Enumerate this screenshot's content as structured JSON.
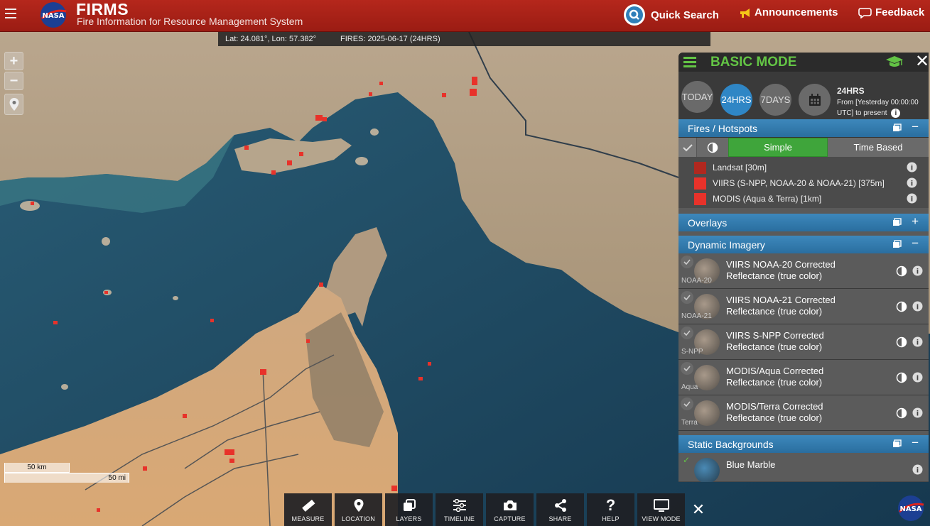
{
  "header": {
    "title": "FIRMS",
    "subtitle": "Fire Information for Resource Management System",
    "logo_text": "NASA",
    "quick_search": "Quick Search",
    "announcements": "Announcements",
    "feedback": "Feedback",
    "accent": "#b5271c"
  },
  "infobar": {
    "coords": "Lat: 24.081°, Lon: 57.382°",
    "fires": "FIRES: 2025-06-17 (24HRS)"
  },
  "zoom": {
    "in": "+",
    "out": "−"
  },
  "scale": {
    "km": "50 km",
    "mi": "50 mi"
  },
  "toolbar": {
    "items": [
      {
        "label": "MEASURE",
        "icon": "ruler-icon"
      },
      {
        "label": "LOCATION",
        "icon": "location-pin-icon"
      },
      {
        "label": "LAYERS",
        "icon": "layers-icon"
      },
      {
        "label": "TIMELINE",
        "icon": "sliders-icon"
      },
      {
        "label": "CAPTURE",
        "icon": "camera-icon"
      },
      {
        "label": "SHARE",
        "icon": "share-icon"
      },
      {
        "label": "HELP",
        "icon": "question-icon"
      },
      {
        "label": "VIEW MODE",
        "icon": "monitor-icon"
      }
    ],
    "close": "✕"
  },
  "panel": {
    "title": "BASIC MODE",
    "close": "✕",
    "time": {
      "buttons": [
        "TODAY",
        "24HRS",
        "7DAYS"
      ],
      "active": "24HRS",
      "heading": "24HRS",
      "line1": "From [Yesterday 00:00:00",
      "line2": "UTC] to present"
    },
    "fires_section": {
      "title": "Fires / Hotspots",
      "toggle": "−",
      "mode_simple": "Simple",
      "mode_time": "Time Based",
      "layers": [
        {
          "name": "Landsat [30m]",
          "color": "#b0281f"
        },
        {
          "name": "VIIRS (S-NPP, NOAA-20 & NOAA-21) [375m]",
          "color": "#e8322a"
        },
        {
          "name": "MODIS (Aqua & Terra) [1km]",
          "color": "#e8322a"
        }
      ]
    },
    "overlays": {
      "title": "Overlays",
      "toggle": "+"
    },
    "dynamic": {
      "title": "Dynamic Imagery",
      "toggle": "−",
      "layers": [
        {
          "tag": "NOAA-20",
          "name": "VIIRS NOAA-20 Corrected Reflectance (true color)"
        },
        {
          "tag": "NOAA-21",
          "name": "VIIRS NOAA-21 Corrected Reflectance (true color)"
        },
        {
          "tag": "S-NPP",
          "name": "VIIRS S-NPP Corrected Reflectance (true color)"
        },
        {
          "tag": "Aqua",
          "name": "MODIS/Aqua Corrected Reflectance (true color)"
        },
        {
          "tag": "Terra",
          "name": "MODIS/Terra Corrected Reflectance (true color)"
        }
      ]
    },
    "static": {
      "title": "Static Backgrounds",
      "toggle": "−",
      "layers": [
        {
          "name": "Blue Marble"
        }
      ]
    }
  }
}
